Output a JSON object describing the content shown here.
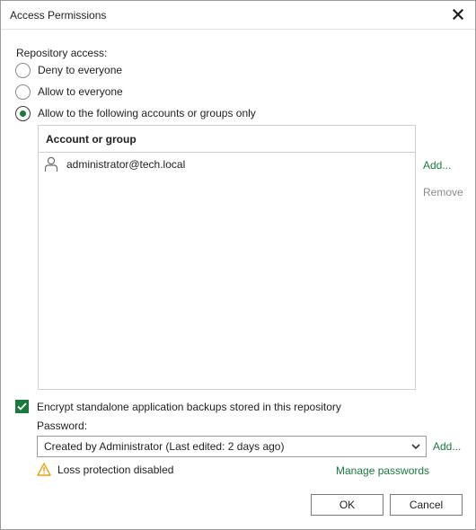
{
  "dialog": {
    "title": "Access Permissions",
    "close_icon": "close-icon"
  },
  "repository_access": {
    "label": "Repository access:",
    "options": [
      {
        "label": "Deny to everyone",
        "selected": false
      },
      {
        "label": "Allow to everyone",
        "selected": false
      },
      {
        "label": "Allow to the following accounts or groups only",
        "selected": true
      }
    ]
  },
  "accounts_table": {
    "header": "Account or group",
    "rows": [
      {
        "icon": "user-icon",
        "name": "administrator@tech.local"
      }
    ]
  },
  "table_actions": {
    "add_label": "Add...",
    "remove_label": "Remove"
  },
  "encryption": {
    "checkbox_label": "Encrypt standalone application backups stored in this repository",
    "checked": true,
    "password_label": "Password:",
    "password_value": "Created by Administrator (Last edited: 2 days ago)",
    "add_label": "Add...",
    "warning_icon": "warning-icon",
    "warning_text": "Loss protection disabled",
    "manage_link": "Manage passwords"
  },
  "footer": {
    "ok_label": "OK",
    "cancel_label": "Cancel"
  },
  "colors": {
    "accent": "#1a7a3e",
    "warning": "#e8a317",
    "disabled_text": "#8c8c8c"
  }
}
